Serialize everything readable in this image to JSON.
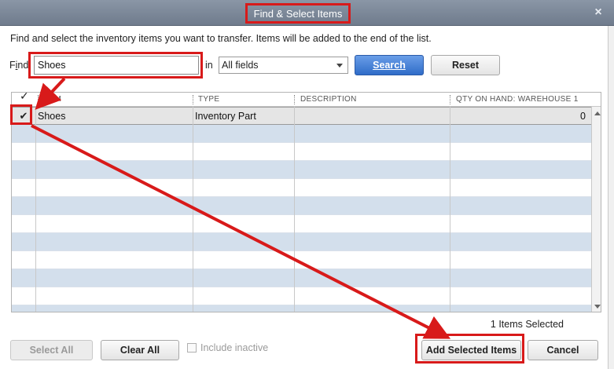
{
  "window": {
    "title": "Find & Select Items",
    "close_glyph": "×"
  },
  "instructions": "Find and select the inventory items you want to transfer.  Items will be added to the end of the list.",
  "find": {
    "label_first": "F",
    "label_underlined": "i",
    "label_rest": "nd",
    "value": "Shoes",
    "in_label": "in",
    "field_selected": "All fields",
    "search_label": "Search",
    "reset_label": "Reset"
  },
  "table": {
    "check_header": "✓",
    "columns": [
      "ITEM",
      "TYPE",
      "DESCRIPTION",
      "QTY ON HAND: WAREHOUSE 1"
    ],
    "rows": [
      {
        "checked": "✔",
        "item": "Shoes",
        "type": "Inventory Part",
        "description": "",
        "qty": "0"
      }
    ]
  },
  "footer": {
    "items_selected": "1 Items Selected",
    "select_all": "Select All",
    "clear_all": "Clear All",
    "include_inactive": "Include inactive",
    "add_selected": "Add Selected Items",
    "cancel": "Cancel"
  },
  "colors": {
    "annotation_red": "#d81a1a",
    "title_bar": "#7a8698",
    "search_blue": "#2f6cc8",
    "row_stripe": "#d3dfec"
  }
}
